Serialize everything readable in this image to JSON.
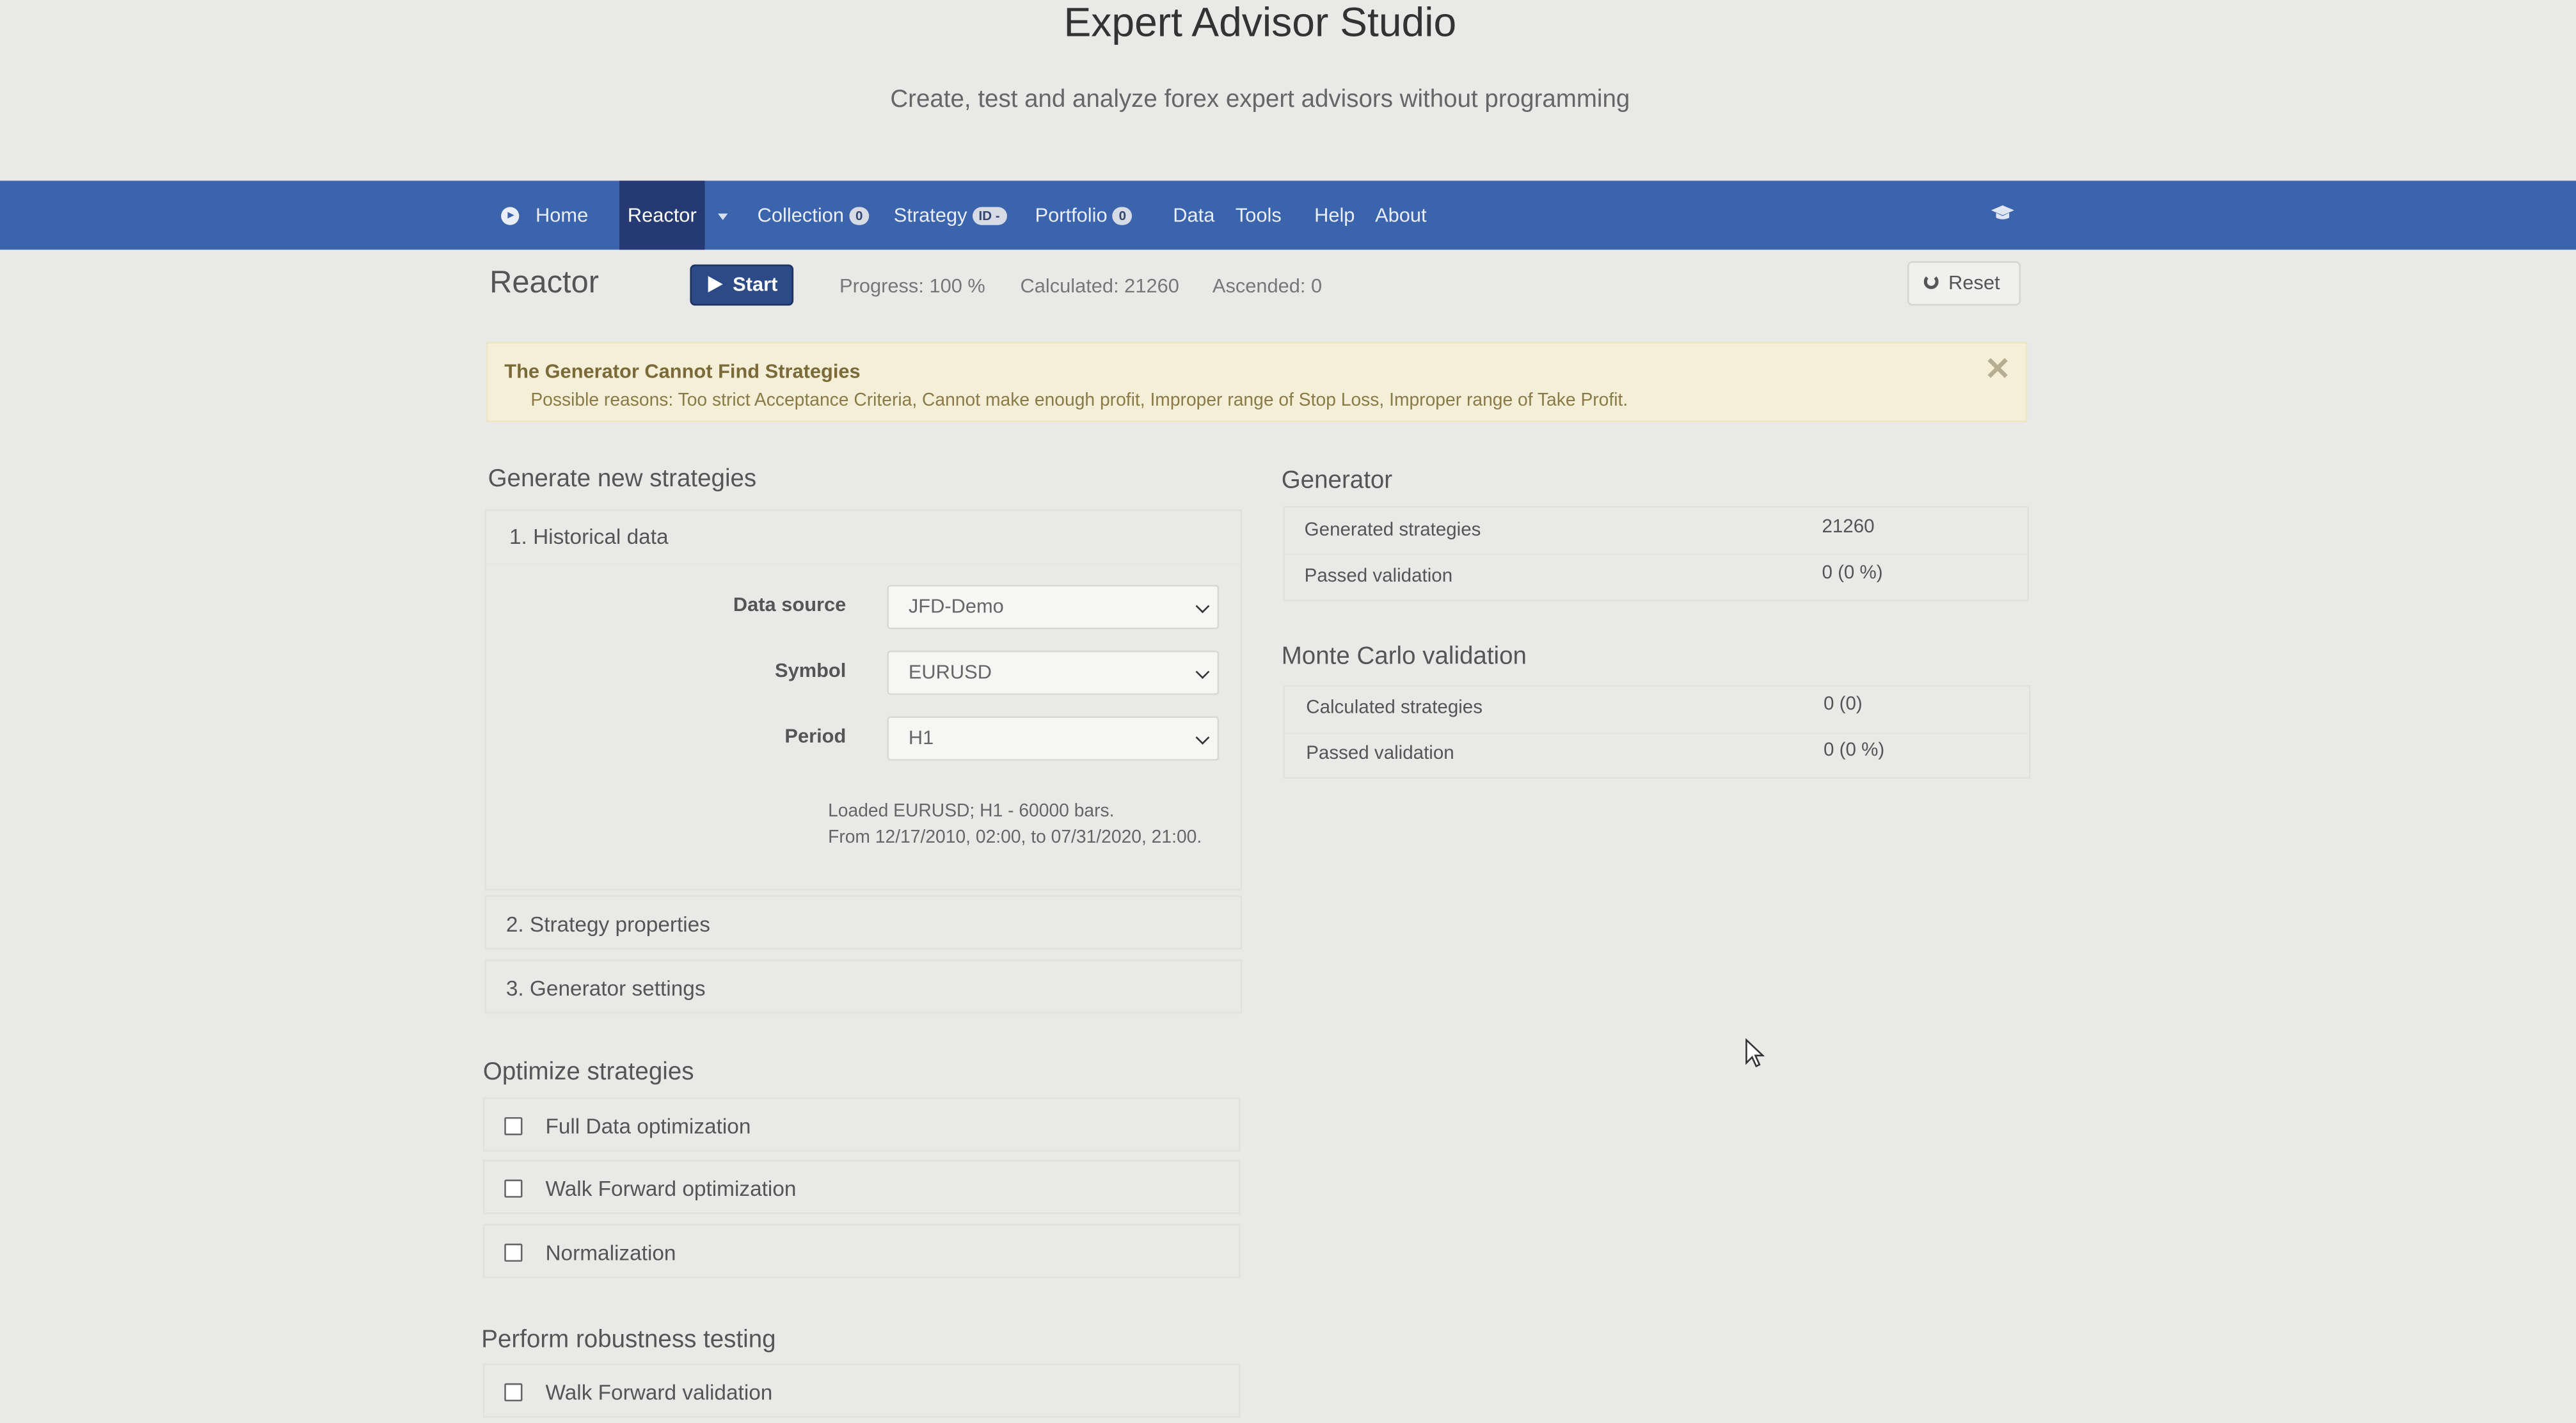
{
  "header": {
    "title": "Expert Advisor Studio",
    "subtitle": "Create, test and analyze forex expert advisors without programming"
  },
  "nav": {
    "home": "Home",
    "reactor": "Reactor",
    "collection": {
      "label": "Collection",
      "badge": "0"
    },
    "strategy": {
      "label": "Strategy",
      "badge": "ID -"
    },
    "portfolio": {
      "label": "Portfolio",
      "badge": "0"
    },
    "data": "Data",
    "tools": "Tools",
    "help": "Help",
    "about": "About"
  },
  "toolbar": {
    "heading": "Reactor",
    "start_label": "Start",
    "progress": "Progress: 100 %",
    "calculated": "Calculated: 21260",
    "ascended": "Ascended: 0",
    "reset_label": "Reset"
  },
  "alert": {
    "title": "The Generator Cannot Find Strategies",
    "text": "Possible reasons: Too strict Acceptance Criteria, Cannot make enough profit, Improper range of Stop Loss, Improper range of Take Profit.",
    "close": "✕"
  },
  "generate": {
    "title": "Generate new strategies",
    "historical": {
      "title": "1. Historical data",
      "data_source_label": "Data source",
      "data_source_value": "JFD-Demo",
      "symbol_label": "Symbol",
      "symbol_value": "EURUSD",
      "period_label": "Period",
      "period_value": "H1",
      "loaded_line1": "Loaded EURUSD; H1 - 60000 bars.",
      "loaded_line2": "From 12/17/2010, 02:00, to 07/31/2020, 21:00."
    },
    "strategy_properties": "2. Strategy properties",
    "generator_settings": "3. Generator settings"
  },
  "optimize": {
    "title": "Optimize strategies",
    "items": [
      "Full Data optimization",
      "Walk Forward optimization",
      "Normalization"
    ]
  },
  "robustness": {
    "title": "Perform robustness testing",
    "items": [
      "Walk Forward validation"
    ]
  },
  "generator": {
    "title": "Generator",
    "rows": [
      {
        "label": "Generated strategies",
        "value": "21260"
      },
      {
        "label": "Passed validation",
        "value": "0 (0 %)"
      }
    ]
  },
  "monte_carlo": {
    "title": "Monte Carlo validation",
    "rows": [
      {
        "label": "Calculated strategies",
        "value": "0 (0)"
      },
      {
        "label": "Passed validation",
        "value": "0 (0 %)"
      }
    ]
  },
  "colors": {
    "navbar": "#3b64ad",
    "nav_active": "#253a73",
    "start_button": "#2b4a86",
    "alert_bg": "#f4efd6"
  },
  "icons": [
    "home-icon",
    "dropdown-caret-icon",
    "graduation-cap-icon",
    "play-icon",
    "refresh-icon",
    "close-icon",
    "chevron-down-icon",
    "checkbox-icon",
    "mouse-cursor-icon"
  ]
}
